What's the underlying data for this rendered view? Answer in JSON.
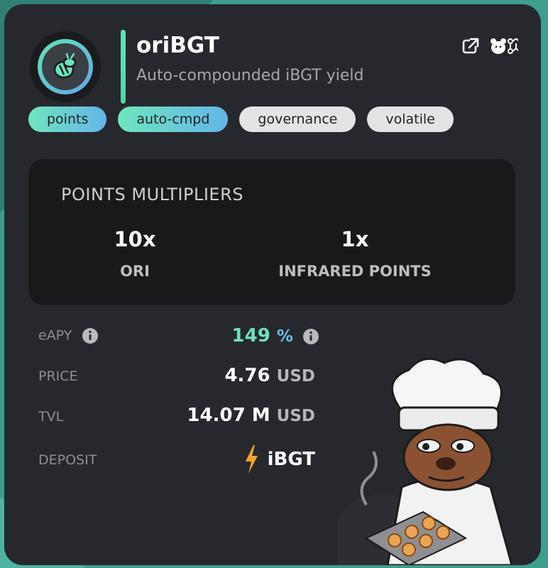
{
  "vault": {
    "name": "oriBGT",
    "description": "Auto-compounded iBGT yield",
    "tags": [
      "points",
      "auto-cmpd",
      "governance",
      "volatile"
    ]
  },
  "points": {
    "title": "POINTS MULTIPLIERS",
    "multipliers": [
      {
        "value": "10x",
        "label": "ORI"
      },
      {
        "value": "1x",
        "label": "INFRARED POINTS"
      }
    ]
  },
  "stats": {
    "eapy_label": "eAPY",
    "eapy_value": "149",
    "eapy_unit": "%",
    "price_label": "PRICE",
    "price_value": "4.76",
    "price_unit": "USD",
    "tvl_label": "TVL",
    "tvl_value": "14.07 M",
    "tvl_unit": "USD",
    "deposit_label": "DEPOSIT",
    "deposit_token": "iBGT"
  },
  "icons": {
    "external_link": "external-link-icon",
    "bear_bridge": "bear-chain-icon",
    "info": "info-icon",
    "bolt": "lightning-icon",
    "logo": "bee-logo-icon"
  },
  "colors": {
    "accent_green": "#5fe5b6",
    "accent_blue": "#5fa9e6",
    "apy_text": "#6fe0bd",
    "card_bg": "#26282d",
    "inner_bg": "#18191b"
  }
}
